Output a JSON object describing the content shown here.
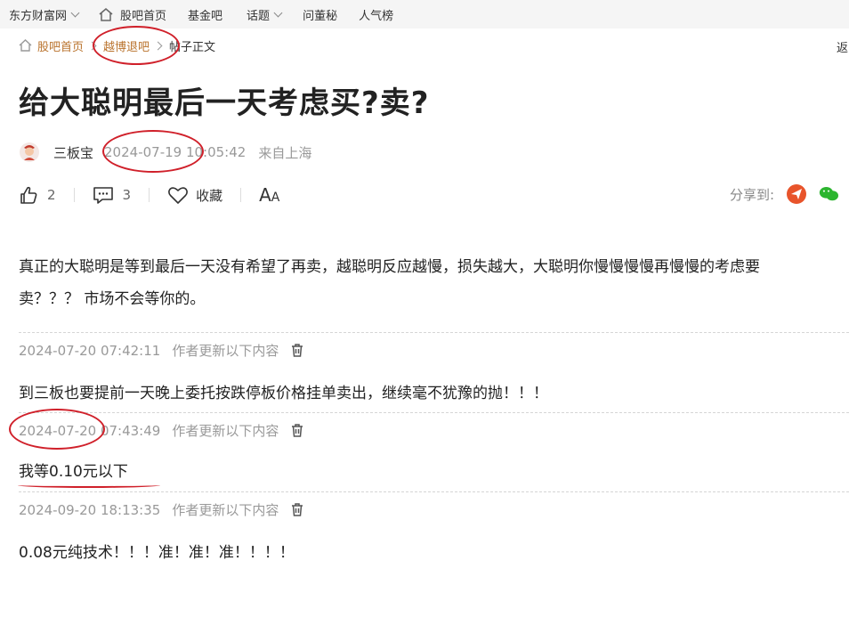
{
  "topnav": {
    "items": [
      {
        "label": "东方财富网",
        "dropdown": true
      },
      {
        "label": "股吧首页",
        "icon": "home-icon"
      },
      {
        "label": "基金吧"
      },
      {
        "label": "话题",
        "dropdown": true
      },
      {
        "label": "问董秘"
      },
      {
        "label": "人气榜"
      }
    ]
  },
  "breadcrumb": {
    "home": "股吧首页",
    "bar": "越博退吧",
    "current": "帖子正文",
    "back": "返"
  },
  "post": {
    "title": "给大聪明最后一天考虑买?卖?",
    "author": "三板宝",
    "time": "2024-07-19 10:05:42",
    "location": "来自上海",
    "likes": "2",
    "comments": "3",
    "favorite_label": "收藏",
    "fontsize_big": "A",
    "fontsize_small": "A",
    "share_label": "分享到:",
    "body_line1": "真正的大聪明是等到最后一天没有希望了再卖，越聪明反应越慢，损失越大，大聪明你慢慢慢慢再慢慢的考虑要",
    "body_line2": "卖？？？ 市场不会等你的。"
  },
  "updates": [
    {
      "time": "2024-07-20 07:42:11",
      "label": "作者更新以下内容",
      "text": "到三板也要提前一天晚上委托按跌停板价格挂单卖出，继续毫不犹豫的抛！！！"
    },
    {
      "time": "2024-07-20 07:43:49",
      "label": "作者更新以下内容",
      "text": "我等0.10元以下"
    },
    {
      "time": "2024-09-20 18:13:35",
      "label": "作者更新以下内容",
      "text": "0.08元纯技术！！！准！准！准！！！！"
    }
  ],
  "colors": {
    "accent": "#b9722b",
    "annotation": "#d0202a",
    "share_red": "#e8542b",
    "share_green": "#2cb52f"
  }
}
